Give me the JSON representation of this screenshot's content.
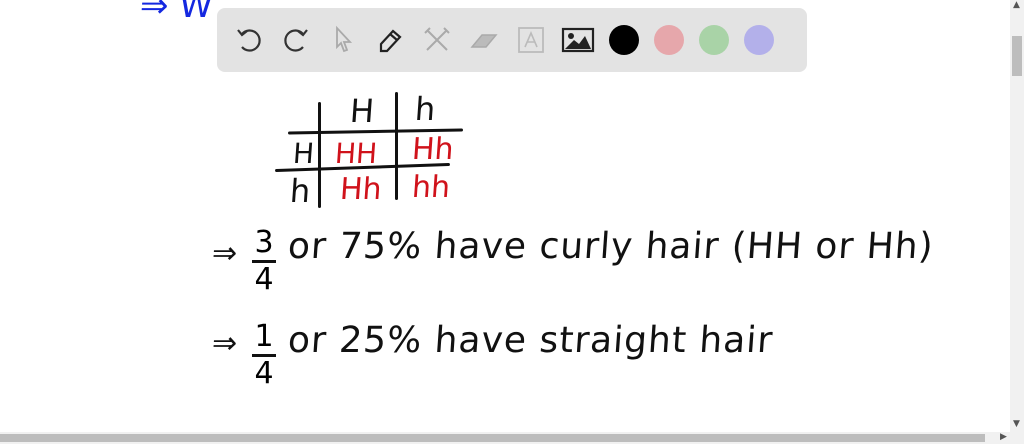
{
  "toolbar": {
    "tools": [
      "undo-icon",
      "redo-icon",
      "select-icon",
      "pen-icon",
      "tools-icon",
      "eraser-icon",
      "text-icon",
      "image-icon"
    ],
    "colors": [
      "#000000",
      "#e6a7ab",
      "#a9d3a7",
      "#b3b0ea"
    ]
  },
  "punnett": {
    "col_headers": [
      "H",
      "h"
    ],
    "row_headers": [
      "H",
      "h"
    ],
    "cells": [
      [
        "HH",
        "Hh"
      ],
      [
        "Hh",
        "hh"
      ]
    ]
  },
  "notes": {
    "line1": {
      "arrow": "⇒",
      "numerator": "3",
      "denominator": "4",
      "text": "or 75% have curly hair (HH or Hh)"
    },
    "line2": {
      "arrow": "⇒",
      "numerator": "1",
      "denominator": "4",
      "text": "or 25% have straight hair"
    }
  },
  "colors": {
    "ink": "#111111",
    "red": "#d0121b",
    "blue": "#1428e0"
  }
}
